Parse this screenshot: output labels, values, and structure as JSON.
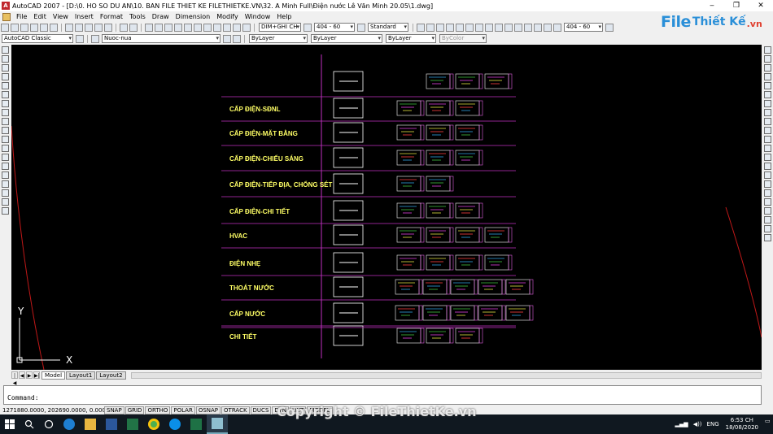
{
  "window": {
    "title": "AutoCAD 2007 - [D:\\0. HO SO DU AN\\10. BAN FILE THIET KE FILETHIETKE.VN\\32. A Minh Full\\Điện nước Lê Văn Minh 20.05\\1.dwg]",
    "app_icon": "A",
    "controls": [
      "‒",
      "❐",
      "✕"
    ]
  },
  "menu": [
    "File",
    "Edit",
    "View",
    "Insert",
    "Format",
    "Tools",
    "Draw",
    "Dimension",
    "Modify",
    "Window",
    "Help"
  ],
  "logo": {
    "main": "File",
    "tail": "Thiết Kế",
    "suffix": ".vn"
  },
  "toolbar1": {
    "dimstyle": "DIM+GHI CH",
    "scale": "404 - 60",
    "textstyle": "Standard",
    "scale2": "404 - 60"
  },
  "toolbar2": {
    "workspace": "AutoCAD Classic",
    "layer": "Nuoc-nua",
    "color": "ByLayer",
    "linetype": "ByLayer",
    "lineweight": "ByLayer",
    "plotstyle": "ByColor"
  },
  "drawing": {
    "rows": [
      {
        "label": ""
      },
      {
        "label": "CẤP ĐIỆN-SĐNL"
      },
      {
        "label": "CẤP ĐIỆN-MẶT BẰNG"
      },
      {
        "label": "CẤP ĐIỆN-CHIẾU SÁNG"
      },
      {
        "label": "CẤP ĐIỆN-TIẾP ĐỊA, CHỐNG SÉT"
      },
      {
        "label": "CẤP ĐIỆN-CHI TIẾT"
      },
      {
        "label": "HVAC"
      },
      {
        "label": "ĐIỆN NHẸ"
      },
      {
        "label": "THOÁT NƯỚC"
      },
      {
        "label": "CẤP NƯỚC"
      },
      {
        "label": "CHI TIẾT"
      }
    ],
    "ucs_y": "Y",
    "ucs_x": "X",
    "colors": {
      "text": "#ffff66",
      "divider": "#c030c0",
      "frame": "#ffffff"
    }
  },
  "tabs": {
    "nav": [
      "|◀",
      "◀",
      "▶",
      "▶|"
    ],
    "items": [
      "Model",
      "Layout1",
      "Layout2"
    ]
  },
  "command": {
    "prompt": "Command:"
  },
  "status": {
    "coords": "1271880.0000, 202690.0000, 0.0000",
    "buttons": [
      "SNAP",
      "GRID",
      "ORTHO",
      "POLAR",
      "OSNAP",
      "OTRACK",
      "DUCS",
      "DYN",
      "LWT",
      "MODEL"
    ]
  },
  "taskbar": {
    "lang": "ENG",
    "time": "6:53 CH",
    "date": "18/08/2020"
  },
  "watermark": "Copyright © FileThietKe.vn"
}
